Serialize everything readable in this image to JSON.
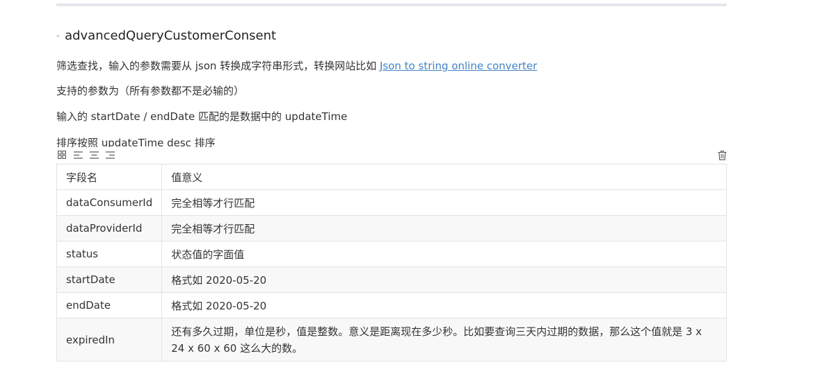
{
  "heading": {
    "marker": "-",
    "title": "advancedQueryCustomerConsent"
  },
  "paragraphs": {
    "p1_text": "筛选查找，输入的参数需要从 json 转换成字符串形式，转换网站比如 ",
    "p1_link": "Json to string online converter",
    "p2": "支持的参数为（所有参数都不是必输的）",
    "p3": "输入的 startDate / endDate 匹配的是数据中的 updateTime",
    "p4": "排序按照 updateTime desc 排序"
  },
  "toolbar": {
    "icons": [
      "table-grid-icon",
      "align-left-icon",
      "align-center-icon",
      "align-right-icon"
    ],
    "delete_icon": "trash-icon"
  },
  "table": {
    "headers": [
      "字段名",
      "值意义"
    ],
    "rows": [
      {
        "field": "dataConsumerId",
        "meaning": "完全相等才行匹配"
      },
      {
        "field": "dataProviderId",
        "meaning": "完全相等才行匹配"
      },
      {
        "field": "status",
        "meaning": "状态值的字面值"
      },
      {
        "field": "startDate",
        "meaning": "格式如 2020-05-20"
      },
      {
        "field": "endDate",
        "meaning": "格式如 2020-05-20"
      },
      {
        "field": "expiredIn",
        "meaning": "还有多久过期，单位是秒，值是整数。意义是距离现在多少秒。比如要查询三天内过期的数据，那么这个值就是 3 x 24 x 60 x 60 这么大的数。"
      }
    ]
  },
  "colors": {
    "link": "#4183c4",
    "border": "#dfe2e5",
    "alt_row": "#f8f8f8",
    "rule": "#e6e6ee"
  }
}
